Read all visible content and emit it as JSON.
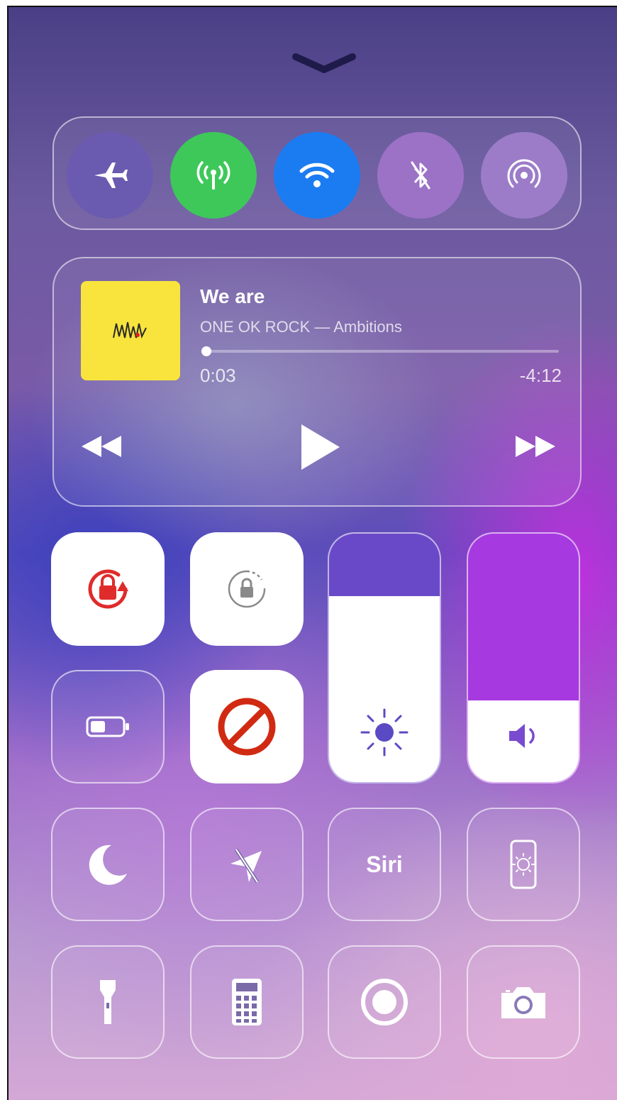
{
  "connectivity": {
    "airplane": {
      "icon": "airplane-icon",
      "active": false,
      "color": "#6a5bb0"
    },
    "cellular": {
      "icon": "cellular-antenna-icon",
      "active": true,
      "color": "#3ec85a"
    },
    "wifi": {
      "icon": "wifi-icon",
      "active": true,
      "color": "#1b7cf2"
    },
    "bluetooth": {
      "icon": "bluetooth-off-icon",
      "active": false,
      "color": "#9c72c6"
    },
    "airdrop": {
      "icon": "airdrop-icon",
      "active": false,
      "color": "#9c7cc8"
    }
  },
  "now_playing": {
    "title": "We are",
    "subtitle": "ONE OK ROCK — Ambitions",
    "elapsed": "0:03",
    "remaining": "-4:12",
    "progress": 0.01,
    "album_color": "#f8e43c"
  },
  "toggles": {
    "orientation_lock": {
      "icon": "orientation-lock-icon",
      "active": true,
      "accent": "#e02b2b"
    },
    "orientation_lock_alt": {
      "icon": "orientation-lock-icon",
      "active": true,
      "accent": "#8a8a8a"
    },
    "low_power": {
      "icon": "battery-icon",
      "active": false
    },
    "do_not_disturb_block": {
      "icon": "prohibited-icon",
      "active": true,
      "accent": "#d12a12"
    },
    "moon": {
      "icon": "moon-icon",
      "active": false
    },
    "location": {
      "icon": "location-off-icon",
      "active": false
    },
    "siri_label": "Siri",
    "screen_mirror": {
      "icon": "phone-brightness-icon",
      "active": false
    },
    "flashlight": {
      "icon": "flashlight-icon"
    },
    "calculator": {
      "icon": "calculator-icon"
    },
    "screen_record": {
      "icon": "screen-record-icon"
    },
    "camera": {
      "icon": "camera-icon"
    }
  },
  "sliders": {
    "brightness": {
      "icon": "sun-icon",
      "level": 0.75
    },
    "volume": {
      "icon": "speaker-icon",
      "level": 0.33
    }
  }
}
